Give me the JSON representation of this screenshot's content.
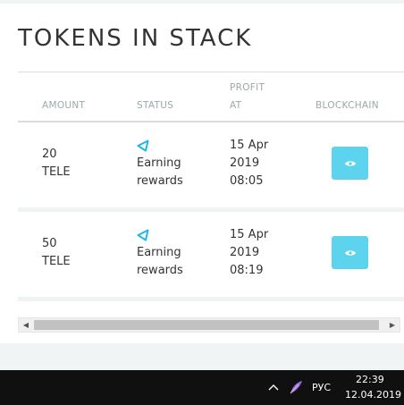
{
  "title": "TOKENS IN STACK",
  "columns": {
    "amount": "AMOUNT",
    "status": "STATUS",
    "profit_line1": "PROFIT",
    "profit_line2": "AT",
    "blockchain": "BLOCKCHAIN"
  },
  "rows": [
    {
      "amount_value": "20",
      "amount_unit": "TELE",
      "status_line1": "Earning",
      "status_line2": "rewards",
      "profit_date": "15 Apr",
      "profit_year": "2019",
      "profit_time": "08:05",
      "blockchain_icon": "eye-icon"
    },
    {
      "amount_value": "50",
      "amount_unit": "TELE",
      "status_line1": "Earning",
      "status_line2": "rewards",
      "profit_date": "15 Apr",
      "profit_year": "2019",
      "profit_time": "08:19",
      "blockchain_icon": "eye-icon"
    }
  ],
  "colors": {
    "accent": "#5ed3ee",
    "status_icon": "#1fb6e8"
  },
  "taskbar": {
    "language": "РУС",
    "time": "22:39",
    "date": "12.04.2019",
    "tray_icons": [
      "chevron-up-icon",
      "feather-icon"
    ]
  }
}
